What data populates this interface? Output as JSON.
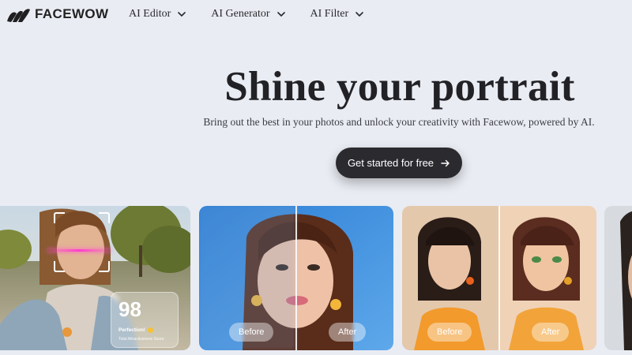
{
  "brand": {
    "name": "FACEWOW",
    "logo_icon": "facewow-logo-icon"
  },
  "nav": {
    "items": [
      {
        "label": "AI Editor",
        "icon": "chevron-down-icon"
      },
      {
        "label": "AI Generator",
        "icon": "chevron-down-icon"
      },
      {
        "label": "AI Filter",
        "icon": "chevron-down-icon"
      }
    ]
  },
  "hero": {
    "title": "Shine your portrait",
    "subtitle": "Bring out the best in your photos and unlock your creativity with Facewow, powered by AI.",
    "cta_label": "Get started for free",
    "cta_icon": "arrow-right-icon"
  },
  "cards": [
    {
      "id": "face-score",
      "score": "98",
      "score_label": "Perfection!",
      "score_caption": "Total Attractiveness Score"
    },
    {
      "id": "enhance",
      "before_label": "Before",
      "after_label": "After"
    },
    {
      "id": "cartoon",
      "before_label": "Before",
      "after_label": "After"
    },
    {
      "id": "partial-card"
    }
  ],
  "colors": {
    "page_bg": "#e9ecf3",
    "text_dark": "#222226",
    "cta_bg": "#2b2b2f",
    "cta_text": "#ffffff",
    "scan_line": "#ff3fd0"
  }
}
